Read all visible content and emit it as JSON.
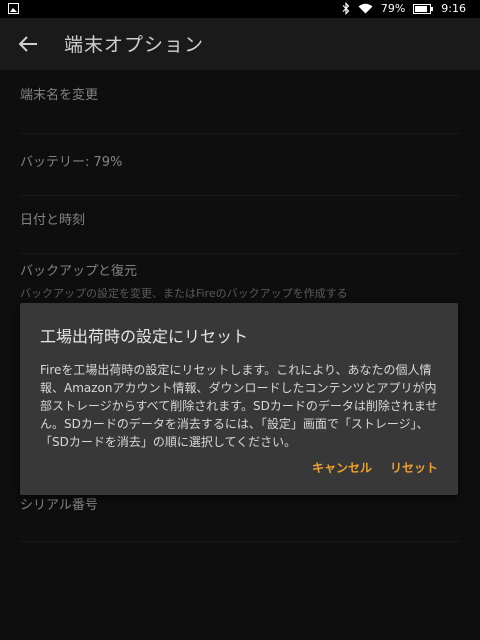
{
  "statusbar": {
    "left_icon": "photo-icon",
    "battery_percent": "79%",
    "time": "9:16",
    "icons": [
      "bluetooth-icon",
      "wifi-icon",
      "battery-icon"
    ]
  },
  "appbar": {
    "title": "端末オプション",
    "back_icon": "back-arrow-icon"
  },
  "settings": {
    "items": [
      {
        "label": "端末名を変更"
      },
      {
        "label": "バッテリー: 79%"
      },
      {
        "label": "日付と時刻"
      },
      {
        "label": "バックアップと復元",
        "sub": "バックアップの設定を変更、またはFireのバックアップを作成する"
      },
      {
        "label": "シリアル番号"
      }
    ]
  },
  "dialog": {
    "title": "工場出荷時の設定にリセット",
    "body": "Fireを工場出荷時の設定にリセットします。これにより、あなたの個人情報、Amazonアカウント情報、ダウンロードしたコンテンツとアプリが内部ストレージからすべて削除されます。SDカードのデータは削除されません。SDカードのデータを消去するには、「設定」画面で「ストレージ」、「SDカードを消去」の順に選択してください。",
    "cancel_label": "キャンセル",
    "reset_label": "リセット"
  },
  "colors": {
    "accent": "#f0a22e",
    "dialog_bg": "#383838",
    "page_bg": "#161616"
  }
}
